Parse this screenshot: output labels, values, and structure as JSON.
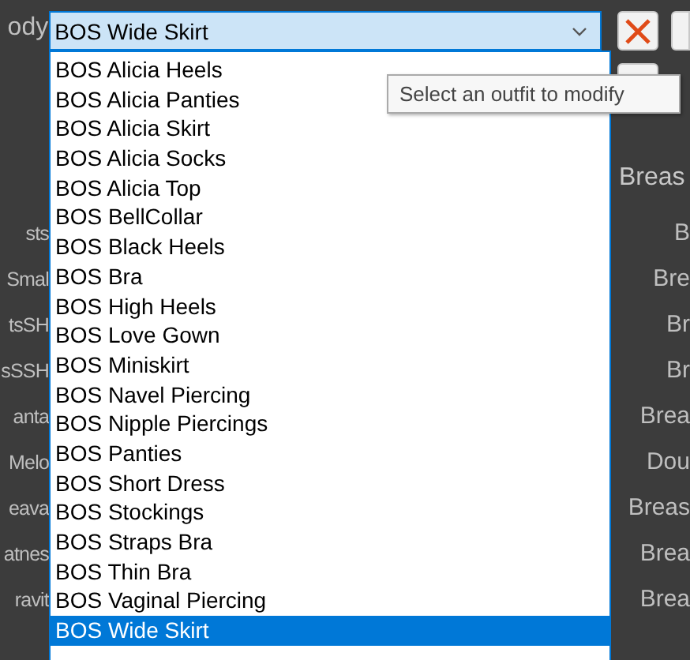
{
  "outfit_field": {
    "label": "ody",
    "value": "BOS Wide Skirt",
    "expanded": true
  },
  "dropdown": {
    "items": [
      {
        "label": "BOS Alicia Heels",
        "selected": false
      },
      {
        "label": "BOS Alicia Panties",
        "selected": false
      },
      {
        "label": "BOS Alicia Skirt",
        "selected": false
      },
      {
        "label": "BOS Alicia Socks",
        "selected": false
      },
      {
        "label": "BOS Alicia Top",
        "selected": false
      },
      {
        "label": "BOS BellCollar",
        "selected": false
      },
      {
        "label": "BOS Black Heels",
        "selected": false
      },
      {
        "label": "BOS Bra",
        "selected": false
      },
      {
        "label": "BOS High Heels",
        "selected": false
      },
      {
        "label": "BOS Love Gown",
        "selected": false
      },
      {
        "label": "BOS Miniskirt",
        "selected": false
      },
      {
        "label": "BOS Navel Piercing",
        "selected": false
      },
      {
        "label": "BOS Nipple Piercings",
        "selected": false
      },
      {
        "label": "BOS Panties",
        "selected": false
      },
      {
        "label": "BOS Short Dress",
        "selected": false
      },
      {
        "label": "BOS Stockings",
        "selected": false
      },
      {
        "label": "BOS Straps Bra",
        "selected": false
      },
      {
        "label": "BOS Thin Bra",
        "selected": false
      },
      {
        "label": "BOS Vaginal Piercing",
        "selected": false
      },
      {
        "label": "BOS Wide Skirt",
        "selected": true
      }
    ]
  },
  "tooltip": "Select an outfit to modify",
  "left_labels": [
    "sts",
    "Smal",
    "tsSH",
    "sSSH",
    "anta",
    "Melo",
    "eava",
    "atnes",
    "ravit"
  ],
  "right_heading": "Breas",
  "right_labels": [
    "B",
    "Bre",
    "Br",
    "Br",
    "Brea",
    "Dou",
    "Breas",
    "Brea",
    "Brea"
  ]
}
